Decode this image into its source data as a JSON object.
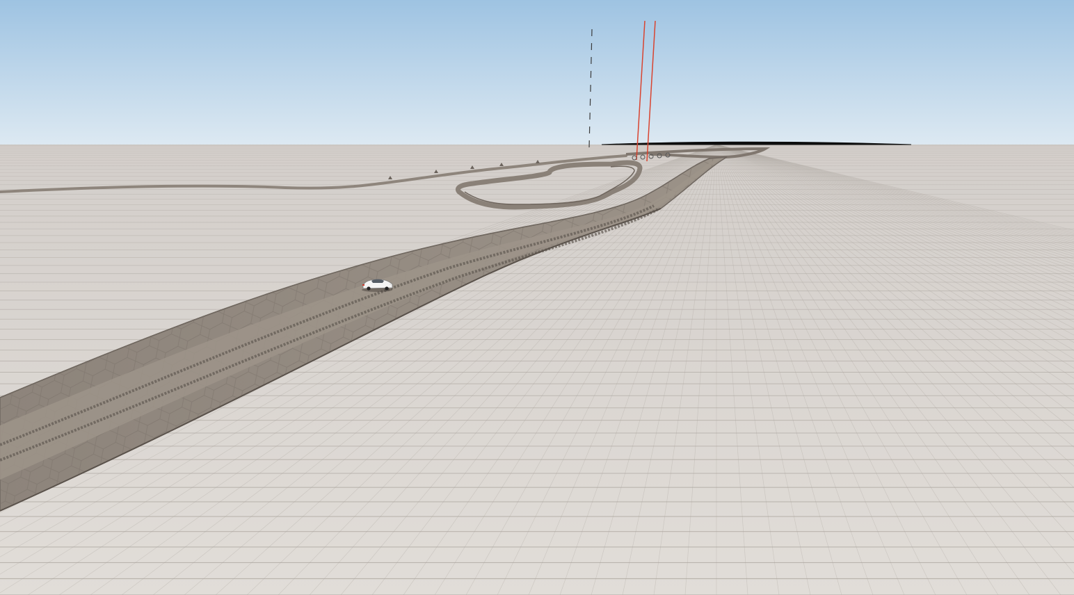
{
  "scene": {
    "type": "3d-driving-sandbox",
    "sky_color_top": "#9ec3e2",
    "sky_color_horizon": "#dde9f2",
    "ground_color": "#d8d4cf",
    "grid_line_color": "#a8a29b",
    "road_color": "#8e857c",
    "road_shoulder_color": "#a39a90",
    "marker_line_color": "#d9432f",
    "vehicle_color": "#f2f2f2",
    "elements": [
      "main-road",
      "distant-road",
      "loop-road",
      "player-vehicle",
      "checkpoint-markers",
      "dashed-marker-pole",
      "horizon-ridge"
    ]
  }
}
